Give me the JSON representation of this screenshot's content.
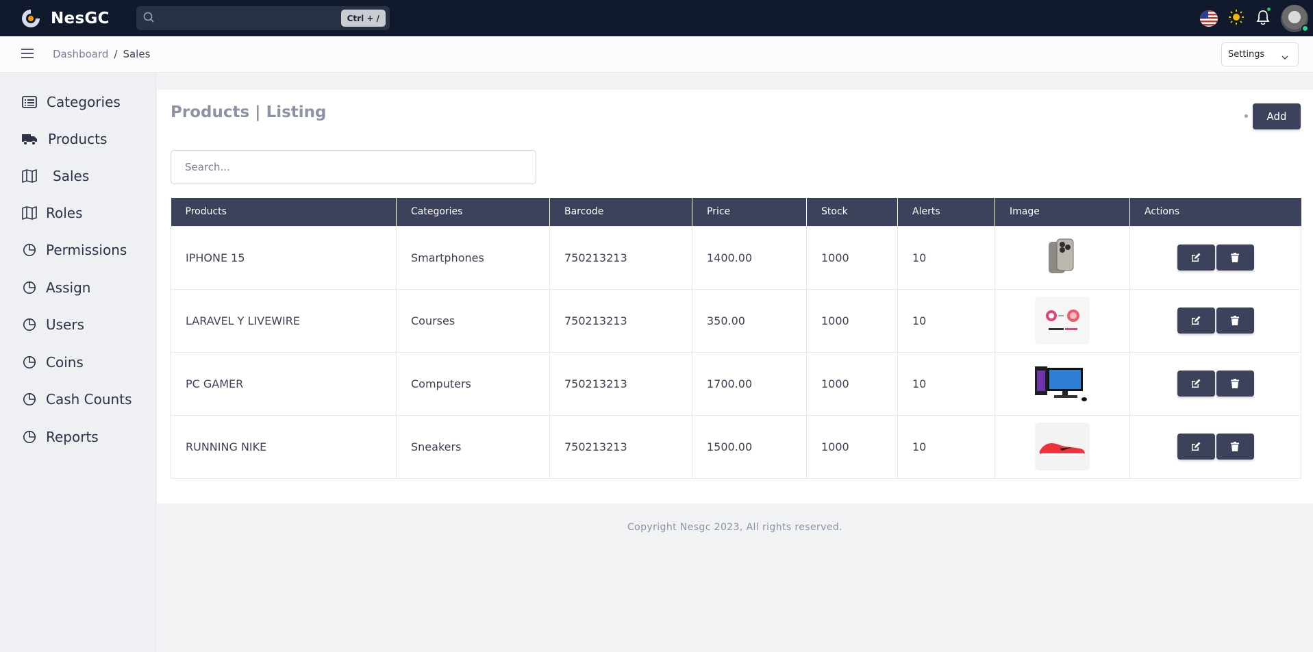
{
  "brand": {
    "name": "NesGC",
    "accent": "#f59e0b"
  },
  "topbar": {
    "search_placeholder": "",
    "shortcut": "Ctrl + /",
    "icons": [
      "search-icon",
      "us-flag-icon",
      "sun-icon",
      "bell-icon",
      "avatar"
    ]
  },
  "breadcrumb": {
    "parent": "Dashboard",
    "separator": "/",
    "current": "Sales"
  },
  "settings": {
    "label": "Settings"
  },
  "sidebar": {
    "items": [
      {
        "label": "Categories",
        "icon": "list-icon"
      },
      {
        "label": "Products",
        "icon": "truck-icon"
      },
      {
        "label": "Sales",
        "icon": "map-icon"
      },
      {
        "label": "Roles",
        "icon": "map-icon"
      },
      {
        "label": "Permissions",
        "icon": "pie-chart-icon"
      },
      {
        "label": "Assign",
        "icon": "pie-chart-icon"
      },
      {
        "label": "Users",
        "icon": "pie-chart-icon"
      },
      {
        "label": "Coins",
        "icon": "pie-chart-icon"
      },
      {
        "label": "Cash Counts",
        "icon": "pie-chart-icon"
      },
      {
        "label": "Reports",
        "icon": "pie-chart-icon"
      }
    ]
  },
  "main": {
    "title": "Products | Listing",
    "add_label": "Add",
    "search_placeholder": "Search...",
    "table": {
      "headers": [
        "Products",
        "Categories",
        "Barcode",
        "Price",
        "Stock",
        "Alerts",
        "Image",
        "Actions"
      ],
      "rows": [
        {
          "product": "IPHONE 15",
          "category": "Smartphones",
          "barcode": "750213213",
          "price": "1400.00",
          "stock": "1000",
          "alerts": "10"
        },
        {
          "product": "LARAVEL Y LIVEWIRE",
          "category": "Courses",
          "barcode": "750213213",
          "price": "350.00",
          "stock": "1000",
          "alerts": "10"
        },
        {
          "product": "PC GAMER",
          "category": "Computers",
          "barcode": "750213213",
          "price": "1700.00",
          "stock": "1000",
          "alerts": "10"
        },
        {
          "product": "RUNNING NIKE",
          "category": "Sneakers",
          "barcode": "750213213",
          "price": "1500.00",
          "stock": "1000",
          "alerts": "10"
        }
      ]
    }
  },
  "footer": {
    "text": "Copyright Nesgc 2023, All rights reserved."
  },
  "colors": {
    "navbar": "#111a2c",
    "table_header": "#3c415c",
    "button": "#3c415c"
  }
}
